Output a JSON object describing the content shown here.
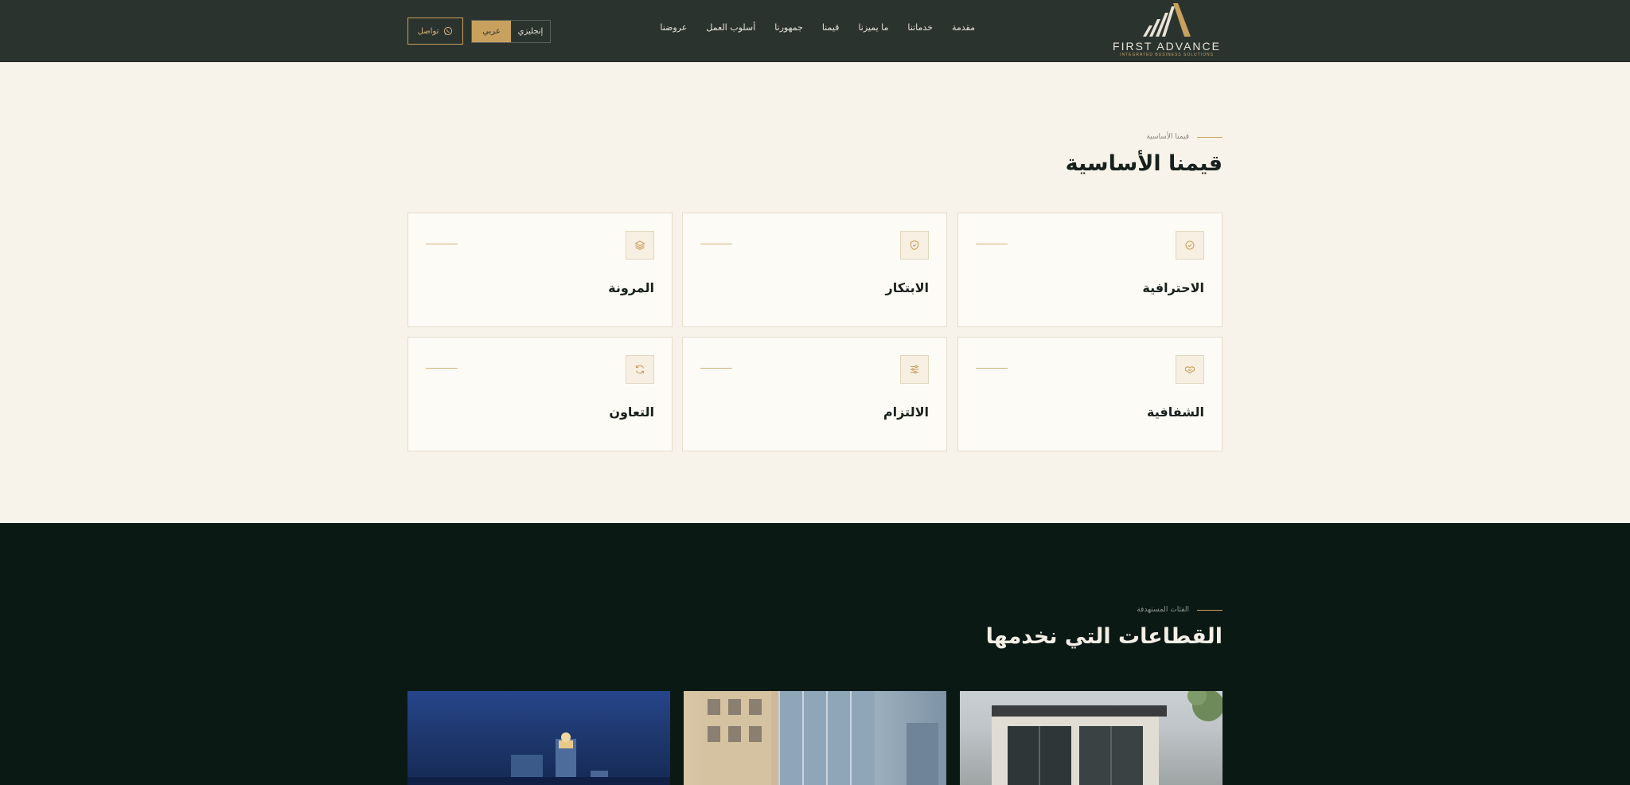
{
  "header": {
    "brand": "FIRST ADVANCE",
    "tagline": "INTEGRATED BUSINESS SOLUTIONS",
    "nav": [
      "مقدمة",
      "خدماتنا",
      "ما يميزنا",
      "قيمنا",
      "جمهورنا",
      "أسلوب العمل",
      "عروضنا"
    ],
    "lang_en": "إنجليزي",
    "lang_ar": "عربي",
    "contact_label": "تواصل"
  },
  "values": {
    "eyebrow": "قيمنا الأساسية",
    "title": "قيمنا الأساسية",
    "cards": [
      {
        "title": "الاحترافية",
        "icon": "check-shield-icon"
      },
      {
        "title": "الابتكار",
        "icon": "shield-icon"
      },
      {
        "title": "المرونة",
        "icon": "layers-icon"
      },
      {
        "title": "الشفافية",
        "icon": "handshake-icon"
      },
      {
        "title": "الالتزام",
        "icon": "sliders-icon"
      },
      {
        "title": "التعاون",
        "icon": "refresh-icon"
      }
    ]
  },
  "sectors": {
    "eyebrow": "الفئات المستهدفة",
    "title": "القطاعات التي نخدمها"
  },
  "colors": {
    "header_bg": "#2b332f",
    "accent_gold": "#c9a15e",
    "page_bg": "#f7f3ea",
    "sectors_bg": "#0b1915"
  }
}
